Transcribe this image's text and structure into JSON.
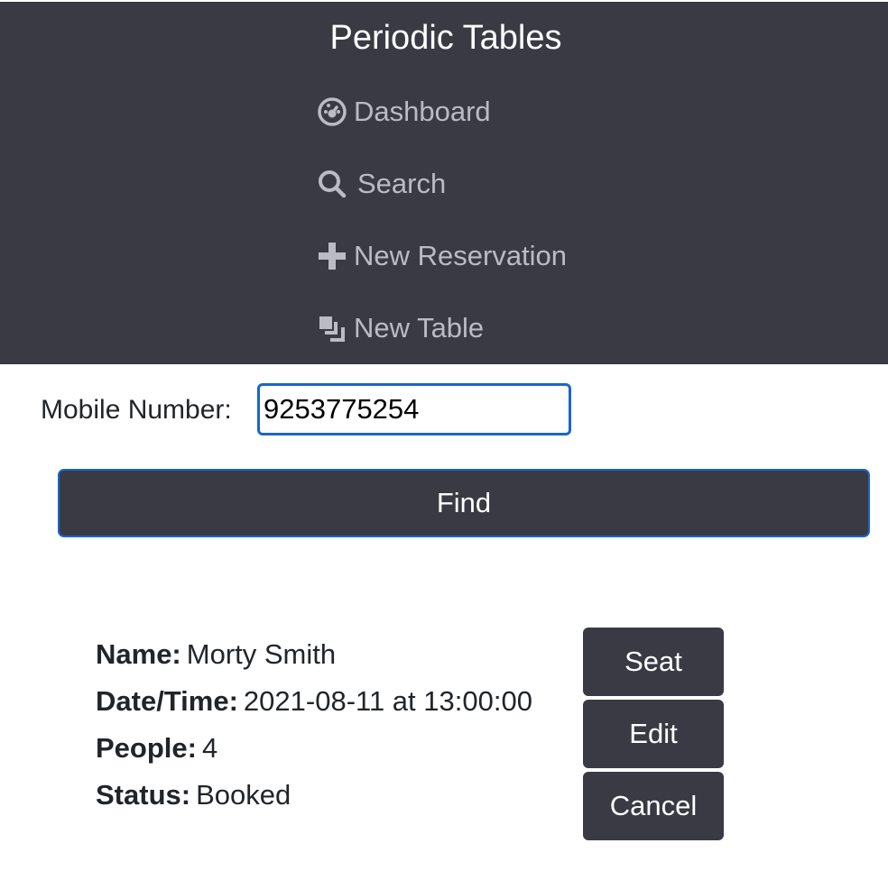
{
  "header": {
    "brand": "Periodic Tables",
    "nav": [
      {
        "label": "Dashboard",
        "icon": "dashboard-icon"
      },
      {
        "label": "Search",
        "icon": "search-icon"
      },
      {
        "label": "New Reservation",
        "icon": "plus-icon"
      },
      {
        "label": "New Table",
        "icon": "layers-icon"
      }
    ]
  },
  "search_form": {
    "mobile_label": "Mobile Number:",
    "mobile_value": "9253775254",
    "find_label": "Find"
  },
  "reservation": {
    "name_key": "Name:",
    "name_value": "Morty Smith",
    "datetime_key": "Date/Time:",
    "datetime_value": "2021-08-11 at 13:00:00",
    "people_key": "People:",
    "people_value": "4",
    "status_key": "Status:",
    "status_value": "Booked",
    "actions": {
      "seat_label": "Seat",
      "edit_label": "Edit",
      "cancel_label": "Cancel"
    }
  },
  "colors": {
    "nav_background": "#3a3a45",
    "nav_text": "#b9bcc2",
    "focus_border": "#1a66c9",
    "button_background": "#3a3a45"
  }
}
